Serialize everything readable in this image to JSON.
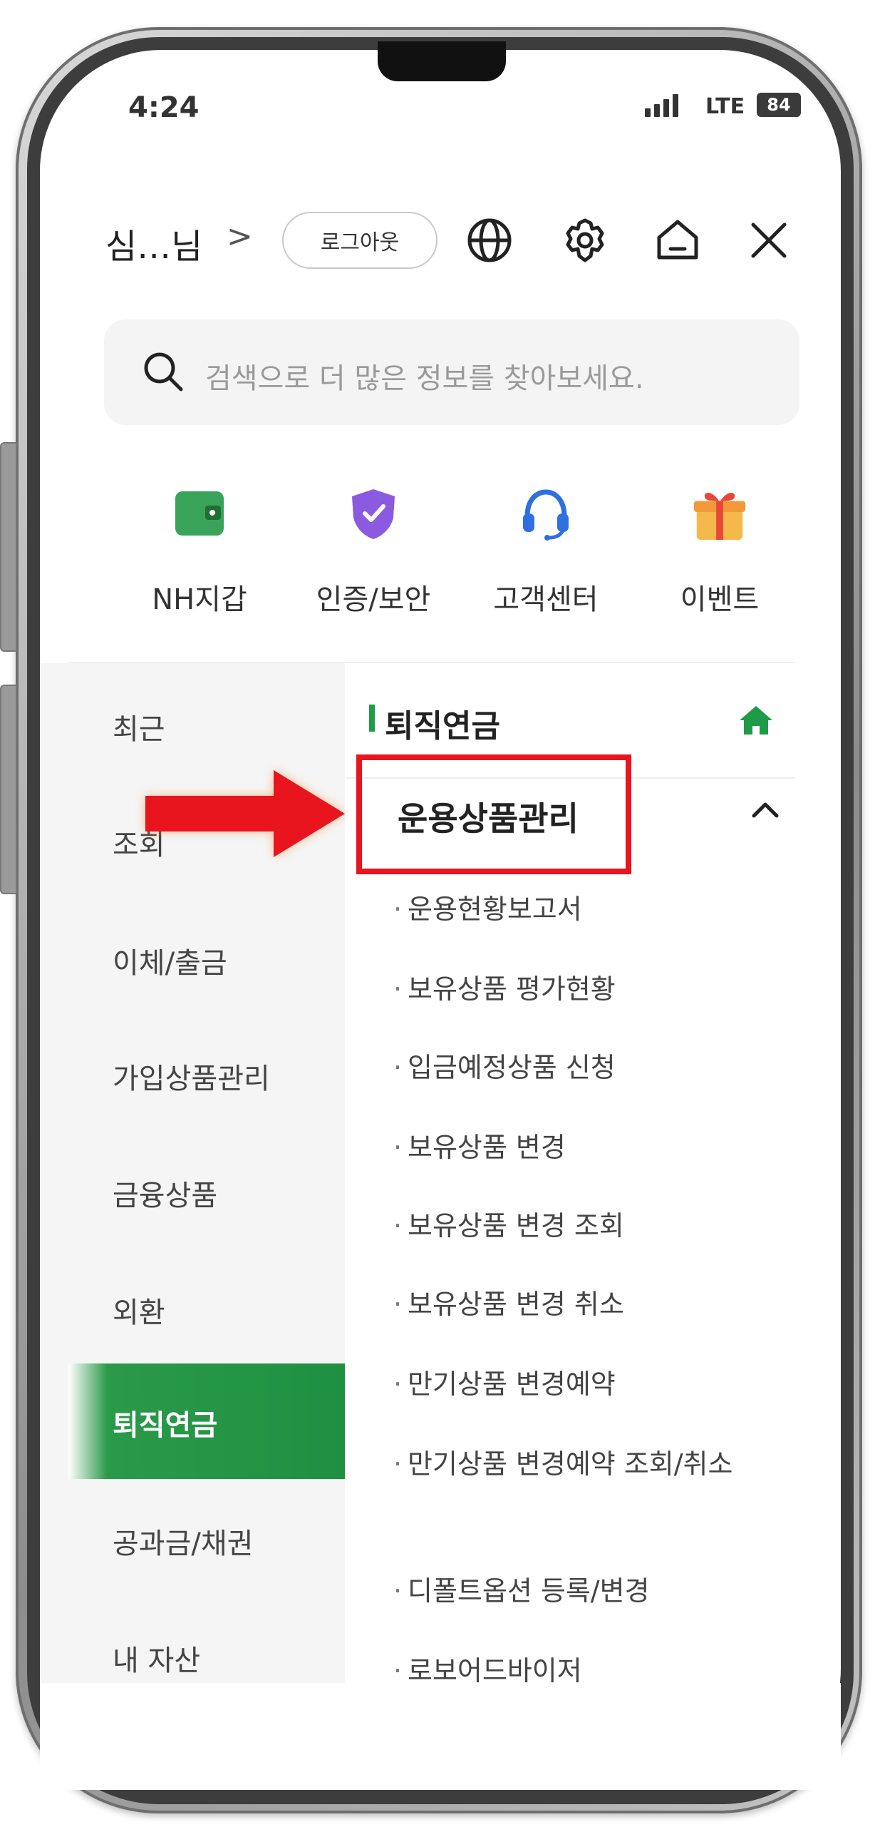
{
  "status_bar": {
    "time": "4:24",
    "network": "LTE",
    "battery": "84"
  },
  "header": {
    "user_name": "심…님",
    "chevron": ">",
    "logout_label": "로그아웃",
    "icons": [
      "globe-icon",
      "gear-icon",
      "home-icon",
      "close-icon"
    ]
  },
  "search": {
    "placeholder": "검색으로 더 많은 정보를 찾아보세요."
  },
  "quick_menu": [
    {
      "label": "NH지갑",
      "icon": "wallet-icon",
      "color": "#3aa35a"
    },
    {
      "label": "인증/보안",
      "icon": "shield-check-icon",
      "color": "#8a5be0"
    },
    {
      "label": "고객센터",
      "icon": "headset-icon",
      "color": "#2f6fe0"
    },
    {
      "label": "이벤트",
      "icon": "gift-icon",
      "color": "#f2a23a"
    }
  ],
  "left_menu": {
    "items": [
      "최근",
      "조회",
      "이체/출금",
      "가입상품관리",
      "금융상품",
      "외환",
      "퇴직연금",
      "공과금/채권",
      "내 자산"
    ],
    "active": "퇴직연금",
    "active_color": "#1f8f41"
  },
  "right_panel": {
    "section_title": "퇴직연금",
    "group_title": "운용상품관리",
    "sub_items": [
      "운용현황보고서",
      "보유상품 평가현황",
      "입금예정상품 신청",
      "보유상품 변경",
      "보유상품 변경 조회",
      "보유상품 변경 취소",
      "만기상품 변경예약",
      "만기상품 변경예약 조회/취소",
      "디폴트옵션 등록/변경",
      "로보어드바이저"
    ],
    "accent_color": "#1f9a46",
    "highlight_color": "#e8141e"
  }
}
